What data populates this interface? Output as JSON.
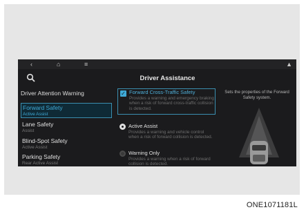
{
  "topbar": {
    "back_icon": "back-chevron-icon",
    "home_icon": "home-icon",
    "menu_icon": "menu-icon",
    "status_icon": "status-icon"
  },
  "header": {
    "title": "Driver Assistance"
  },
  "sidebar": {
    "category": "Driver Attention Warning",
    "items": [
      {
        "name": "Forward Safety",
        "sub": "Active Assist",
        "selected": true
      },
      {
        "name": "Lane Safety",
        "sub": "Assist",
        "selected": false
      },
      {
        "name": "Blind-Spot Safety",
        "sub": "Active Assist",
        "selected": false
      },
      {
        "name": "Parking Safety",
        "sub": "Rear Active Assist",
        "selected": false
      }
    ]
  },
  "options": {
    "fcts": {
      "label": "Forward Cross-Traffic Safety",
      "desc": "Provides a warning and emergency braking when a risk of forward cross-traffic collision is detected.",
      "checked": true
    },
    "active_assist": {
      "label": "Active Assist",
      "desc": "Provides a warning and vehicle control when a risk of forward collision is detected.",
      "selected": true
    },
    "warning_only": {
      "label": "Warning Only",
      "desc": "Provides a warning when a risk of forward collision is detected.",
      "selected": false
    }
  },
  "info": {
    "text": "Sets the properties of the Forward Safety system."
  },
  "caption": "ONE1071181L",
  "colors": {
    "screen_bg": "#1b1b1d",
    "accent": "#3fa9d6",
    "frame_bg": "#e6e6e6"
  }
}
